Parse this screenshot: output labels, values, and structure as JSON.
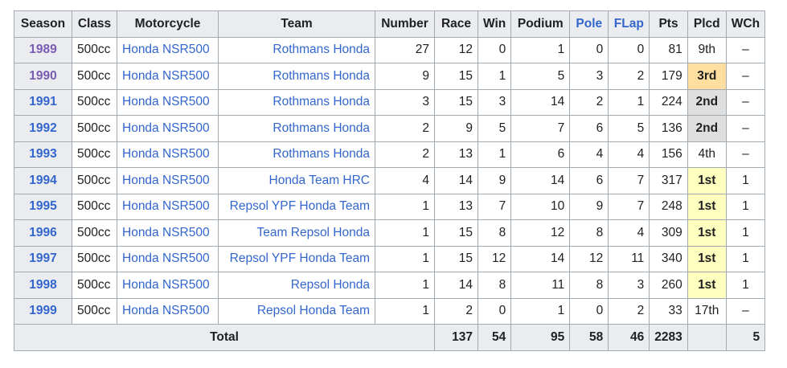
{
  "columns": [
    "Season",
    "Class",
    "Motorcycle",
    "Team",
    "Number",
    "Race",
    "Win",
    "Podium",
    "Pole",
    "FLap",
    "Pts",
    "Plcd",
    "WCh"
  ],
  "rows": [
    {
      "season": "1989",
      "cls": "500cc",
      "moto": "Honda NSR500",
      "team": "Rothmans Honda",
      "number": "27",
      "race": "12",
      "win": "0",
      "podium": "1",
      "pole": "0",
      "flap": "0",
      "pts": "81",
      "plcd": "9th",
      "wch": "–",
      "medal": "",
      "visited": true
    },
    {
      "season": "1990",
      "cls": "500cc",
      "moto": "Honda NSR500",
      "team": "Rothmans Honda",
      "number": "9",
      "race": "15",
      "win": "1",
      "podium": "5",
      "pole": "3",
      "flap": "2",
      "pts": "179",
      "plcd": "3rd",
      "wch": "–",
      "medal": "bronze",
      "visited": true
    },
    {
      "season": "1991",
      "cls": "500cc",
      "moto": "Honda NSR500",
      "team": "Rothmans Honda",
      "number": "3",
      "race": "15",
      "win": "3",
      "podium": "14",
      "pole": "2",
      "flap": "1",
      "pts": "224",
      "plcd": "2nd",
      "wch": "–",
      "medal": "silver",
      "visited": false
    },
    {
      "season": "1992",
      "cls": "500cc",
      "moto": "Honda NSR500",
      "team": "Rothmans Honda",
      "number": "2",
      "race": "9",
      "win": "5",
      "podium": "7",
      "pole": "6",
      "flap": "5",
      "pts": "136",
      "plcd": "2nd",
      "wch": "–",
      "medal": "silver",
      "visited": false
    },
    {
      "season": "1993",
      "cls": "500cc",
      "moto": "Honda NSR500",
      "team": "Rothmans Honda",
      "number": "2",
      "race": "13",
      "win": "1",
      "podium": "6",
      "pole": "4",
      "flap": "4",
      "pts": "156",
      "plcd": "4th",
      "wch": "–",
      "medal": "",
      "visited": false
    },
    {
      "season": "1994",
      "cls": "500cc",
      "moto": "Honda NSR500",
      "team": "Honda Team HRC",
      "number": "4",
      "race": "14",
      "win": "9",
      "podium": "14",
      "pole": "6",
      "flap": "7",
      "pts": "317",
      "plcd": "1st",
      "wch": "1",
      "medal": "gold",
      "visited": false
    },
    {
      "season": "1995",
      "cls": "500cc",
      "moto": "Honda NSR500",
      "team": "Repsol YPF Honda Team",
      "number": "1",
      "race": "13",
      "win": "7",
      "podium": "10",
      "pole": "9",
      "flap": "7",
      "pts": "248",
      "plcd": "1st",
      "wch": "1",
      "medal": "gold",
      "visited": false
    },
    {
      "season": "1996",
      "cls": "500cc",
      "moto": "Honda NSR500",
      "team": "Team Repsol Honda",
      "number": "1",
      "race": "15",
      "win": "8",
      "podium": "12",
      "pole": "8",
      "flap": "4",
      "pts": "309",
      "plcd": "1st",
      "wch": "1",
      "medal": "gold",
      "visited": false
    },
    {
      "season": "1997",
      "cls": "500cc",
      "moto": "Honda NSR500",
      "team": "Repsol YPF Honda Team",
      "number": "1",
      "race": "15",
      "win": "12",
      "podium": "14",
      "pole": "12",
      "flap": "11",
      "pts": "340",
      "plcd": "1st",
      "wch": "1",
      "medal": "gold",
      "visited": false
    },
    {
      "season": "1998",
      "cls": "500cc",
      "moto": "Honda NSR500",
      "team": "Repsol Honda",
      "number": "1",
      "race": "14",
      "win": "8",
      "podium": "11",
      "pole": "8",
      "flap": "3",
      "pts": "260",
      "plcd": "1st",
      "wch": "1",
      "medal": "gold",
      "visited": false
    },
    {
      "season": "1999",
      "cls": "500cc",
      "moto": "Honda NSR500",
      "team": "Repsol Honda Team",
      "number": "1",
      "race": "2",
      "win": "0",
      "podium": "1",
      "pole": "0",
      "flap": "2",
      "pts": "33",
      "plcd": "17th",
      "wch": "–",
      "medal": "",
      "visited": false
    }
  ],
  "total": {
    "label": "Total",
    "race": "137",
    "win": "54",
    "podium": "95",
    "pole": "58",
    "flap": "46",
    "pts": "2283",
    "plcd": "",
    "wch": "5"
  },
  "colors": {
    "link": "#3366cc",
    "visited_link": "#795cb2",
    "gold": "#ffffbf",
    "silver": "#dfdfdf",
    "bronze": "#ffdf9f",
    "header_bg": "#eaecf0",
    "border": "#a2a9b1"
  }
}
